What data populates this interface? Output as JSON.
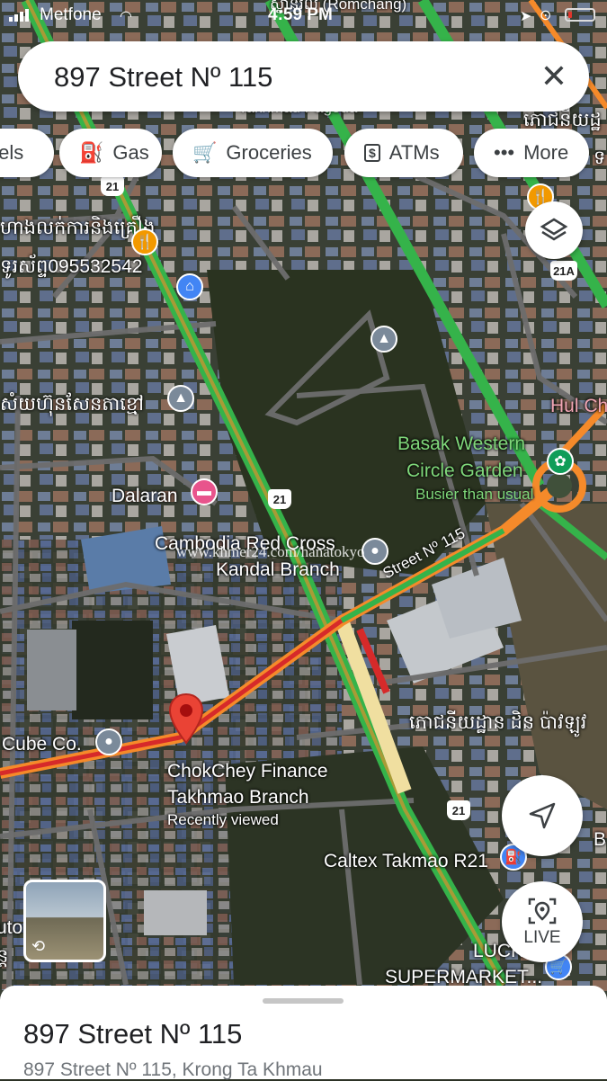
{
  "status_bar": {
    "carrier": "Metfone",
    "time": "4:59 PM",
    "battery_level": 0.15
  },
  "search": {
    "query": "897 Street Nº 115"
  },
  "chips": [
    {
      "label": "tels",
      "icon": "hotel-icon"
    },
    {
      "label": "Gas",
      "icon": "gas-pump-icon"
    },
    {
      "label": "Groceries",
      "icon": "cart-icon"
    },
    {
      "label": "ATMs",
      "icon": "atm-icon"
    },
    {
      "label": "More",
      "icon": "more-dots-icon"
    }
  ],
  "map_labels": {
    "top_partial": "ស្ពានរលំ (Romchang)",
    "top_pagoda": "Takhmau Pagoda",
    "top_right_khmer": "ភោជនីយដ្ឋ",
    "left_khmer_1": "ហាងលក់ការនិងគ្រឿង",
    "left_phone": "ទូរស័ព្ទ095532542",
    "left_khmer_2": "សំយហ៊ុនសែនតាខ្មៅ",
    "hul": "Hul Ch",
    "basak_1": "Basak Western",
    "basak_2": "Circle Garden",
    "basak_sub": "Busier than usual",
    "dalaran": "Dalaran",
    "redcross_1": "Cambodia Red Cross",
    "redcross_2": "Kandal Branch",
    "street": "Street Nº 115",
    "khmer_restaurant": "ភោជនីយដ្ឋាន ដិន ប៉ាវឡូវ",
    "cube": "Cube Co.",
    "chokchey_1": "ChokChey Finance",
    "chokchey_2": "Takhmao Branch",
    "chokchey_sub": "Recently viewed",
    "caltex": "Caltex Takmao R21",
    "lucky_1": "LUCK",
    "lucky_2": "SUPERMARKET...",
    "left_edge_1": "uto",
    "left_edge_2": "ន្ត",
    "right_edge_b": "B",
    "right_edge_khmer": "ទ"
  },
  "road_shields": [
    "21",
    "21",
    "21",
    "21A"
  ],
  "watermark": "www.khmer24.com/hanatokyo",
  "buttons": {
    "live": "LIVE"
  },
  "place": {
    "title": "897 Street Nº 115",
    "address": "897 Street Nº 115, Krong Ta Khmau"
  }
}
